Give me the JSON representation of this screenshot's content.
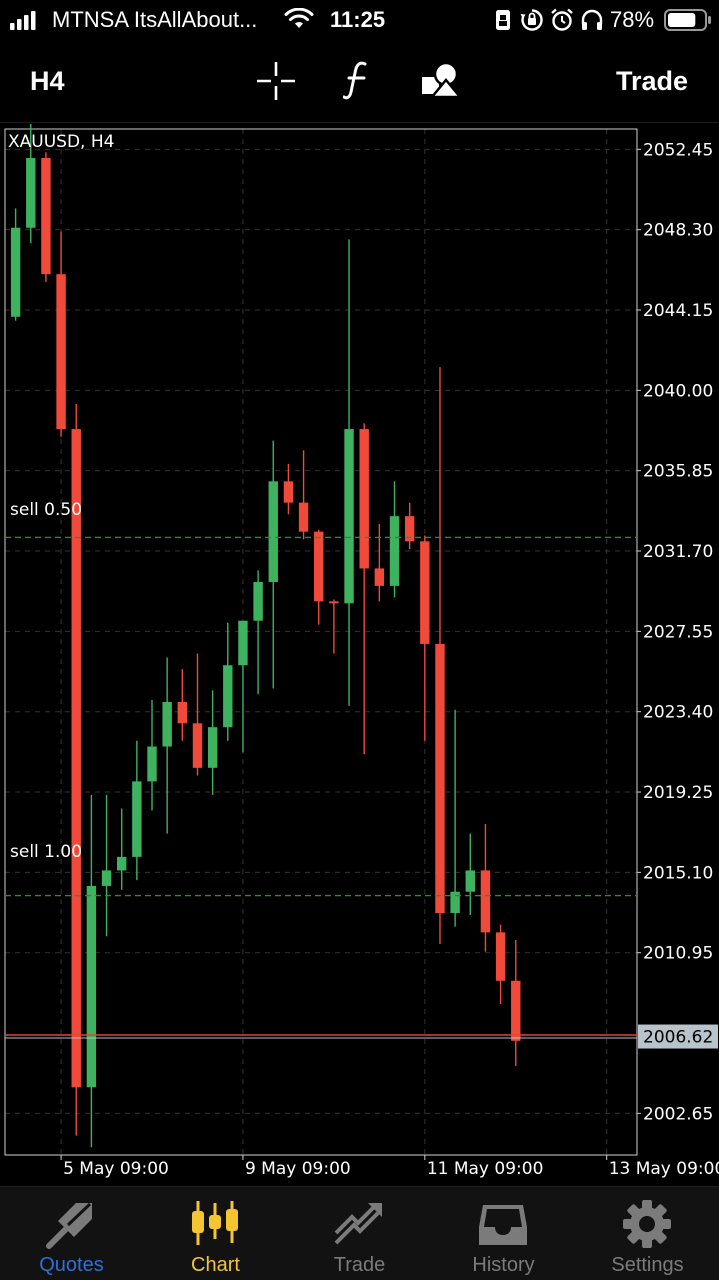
{
  "status_bar": {
    "carrier": "MTNSA ItsAllAbout...",
    "time": "11:25",
    "battery": "78%",
    "battery_level": 0.78,
    "icons": [
      "signal-icon",
      "wifi-icon",
      "portrait-lock-icon",
      "rotation-lock-icon",
      "alarm-icon",
      "headphones-icon",
      "battery-icon"
    ]
  },
  "toolbar": {
    "period": "H4",
    "trade_label": "Trade",
    "icons": [
      "crosshair-icon",
      "indicators-icon",
      "objects-icon"
    ]
  },
  "chart": {
    "title": "XAUUSD, H4",
    "price_labels": [
      "2052.45",
      "2048.30",
      "2044.15",
      "2040.00",
      "2035.85",
      "2031.70",
      "2027.55",
      "2023.40",
      "2019.25",
      "2015.10",
      "2010.95",
      "2002.65"
    ],
    "current_price": "2006.62",
    "date_labels": [
      "5 May 09:00",
      "9 May 09:00",
      "11 May 09:00",
      "13 May 09:00"
    ],
    "orders": [
      {
        "label": "sell 0.50",
        "price": 2032.4
      },
      {
        "label": "sell 1.00",
        "price": 2013.9
      }
    ],
    "colors": {
      "bull": "#3fb25f",
      "bear": "#f04a3b",
      "grid": "#333333",
      "order_line": "#2e8b3a",
      "price_line": "#e0443a",
      "price_tag_bg": "#b9c3cc"
    }
  },
  "chart_data": {
    "type": "candlestick",
    "title": "XAUUSD, H4",
    "ylim": [
      2000.5,
      2053.5
    ],
    "current_price": 2006.62,
    "candles": [
      {
        "o": 2043.8,
        "h": 2049.4,
        "l": 2043.6,
        "c": 2048.4
      },
      {
        "o": 2048.4,
        "h": 2054.1,
        "l": 2047.6,
        "c": 2052.0
      },
      {
        "o": 2052.0,
        "h": 2052.3,
        "l": 2045.6,
        "c": 2046.0
      },
      {
        "o": 2046.0,
        "h": 2048.2,
        "l": 2037.6,
        "c": 2038.0
      },
      {
        "o": 2038.0,
        "h": 2039.3,
        "l": 2001.5,
        "c": 2004.0
      },
      {
        "o": 2004.0,
        "h": 2019.1,
        "l": 2000.9,
        "c": 2014.4
      },
      {
        "o": 2014.4,
        "h": 2019.1,
        "l": 2011.8,
        "c": 2015.2
      },
      {
        "o": 2015.2,
        "h": 2018.4,
        "l": 2014.2,
        "c": 2015.9
      },
      {
        "o": 2015.9,
        "h": 2021.9,
        "l": 2014.7,
        "c": 2019.8
      },
      {
        "o": 2019.8,
        "h": 2024.0,
        "l": 2018.3,
        "c": 2021.6
      },
      {
        "o": 2021.6,
        "h": 2026.2,
        "l": 2017.1,
        "c": 2023.9
      },
      {
        "o": 2023.9,
        "h": 2025.6,
        "l": 2021.9,
        "c": 2022.8
      },
      {
        "o": 2022.8,
        "h": 2026.4,
        "l": 2020.1,
        "c": 2020.5
      },
      {
        "o": 2020.5,
        "h": 2024.5,
        "l": 2019.1,
        "c": 2022.6
      },
      {
        "o": 2022.6,
        "h": 2028.0,
        "l": 2021.9,
        "c": 2025.8
      },
      {
        "o": 2025.8,
        "h": 2027.4,
        "l": 2021.3,
        "c": 2028.1
      },
      {
        "o": 2028.1,
        "h": 2030.7,
        "l": 2024.3,
        "c": 2030.1
      },
      {
        "o": 2030.1,
        "h": 2037.4,
        "l": 2024.6,
        "c": 2035.3
      },
      {
        "o": 2035.3,
        "h": 2036.2,
        "l": 2033.6,
        "c": 2034.2
      },
      {
        "o": 2034.2,
        "h": 2036.9,
        "l": 2032.3,
        "c": 2032.7
      },
      {
        "o": 2032.7,
        "h": 2032.8,
        "l": 2027.9,
        "c": 2029.1
      },
      {
        "o": 2029.1,
        "h": 2029.2,
        "l": 2026.4,
        "c": 2029.0
      },
      {
        "o": 2029.0,
        "h": 2047.8,
        "l": 2023.7,
        "c": 2038.0
      },
      {
        "o": 2038.0,
        "h": 2038.3,
        "l": 2021.2,
        "c": 2030.8
      },
      {
        "o": 2030.8,
        "h": 2033.1,
        "l": 2029.1,
        "c": 2029.9
      },
      {
        "o": 2029.9,
        "h": 2035.3,
        "l": 2029.3,
        "c": 2033.5
      },
      {
        "o": 2033.5,
        "h": 2034.2,
        "l": 2031.8,
        "c": 2032.2
      },
      {
        "o": 2032.2,
        "h": 2032.5,
        "l": 2021.9,
        "c": 2026.9
      },
      {
        "o": 2026.9,
        "h": 2041.2,
        "l": 2011.4,
        "c": 2013.0
      },
      {
        "o": 2013.0,
        "h": 2023.5,
        "l": 2012.3,
        "c": 2014.1
      },
      {
        "o": 2014.1,
        "h": 2017.1,
        "l": 2012.9,
        "c": 2015.2
      },
      {
        "o": 2015.2,
        "h": 2017.6,
        "l": 2011.0,
        "c": 2012.0
      },
      {
        "o": 2012.0,
        "h": 2012.4,
        "l": 2008.3,
        "c": 2009.5
      },
      {
        "o": 2009.5,
        "h": 2011.6,
        "l": 2005.1,
        "c": 2006.4
      }
    ],
    "y_ticks": [
      2052.45,
      2048.3,
      2044.15,
      2040.0,
      2035.85,
      2031.7,
      2027.55,
      2023.4,
      2019.25,
      2015.1,
      2010.95,
      2002.65
    ],
    "x_ticks": [
      {
        "index": 3,
        "label": "5 May 09:00"
      },
      {
        "index": 15,
        "label": "9 May 09:00"
      },
      {
        "index": 27,
        "label": "11 May 09:00"
      },
      {
        "index": 39,
        "label": "13 May 09:00"
      }
    ],
    "x_index_range": [
      -0.7,
      41
    ],
    "grid": true
  },
  "tabbar": {
    "tabs": [
      {
        "label": "Quotes",
        "icon": "quotes-icon",
        "color": "#2f6fd8"
      },
      {
        "label": "Chart",
        "icon": "chart-icon",
        "color": "#f3c531"
      },
      {
        "label": "Trade",
        "icon": "trade-icon",
        "color": "#7b7b7b"
      },
      {
        "label": "History",
        "icon": "history-icon",
        "color": "#7b7b7b"
      },
      {
        "label": "Settings",
        "icon": "settings-icon",
        "color": "#7b7b7b"
      }
    ]
  }
}
